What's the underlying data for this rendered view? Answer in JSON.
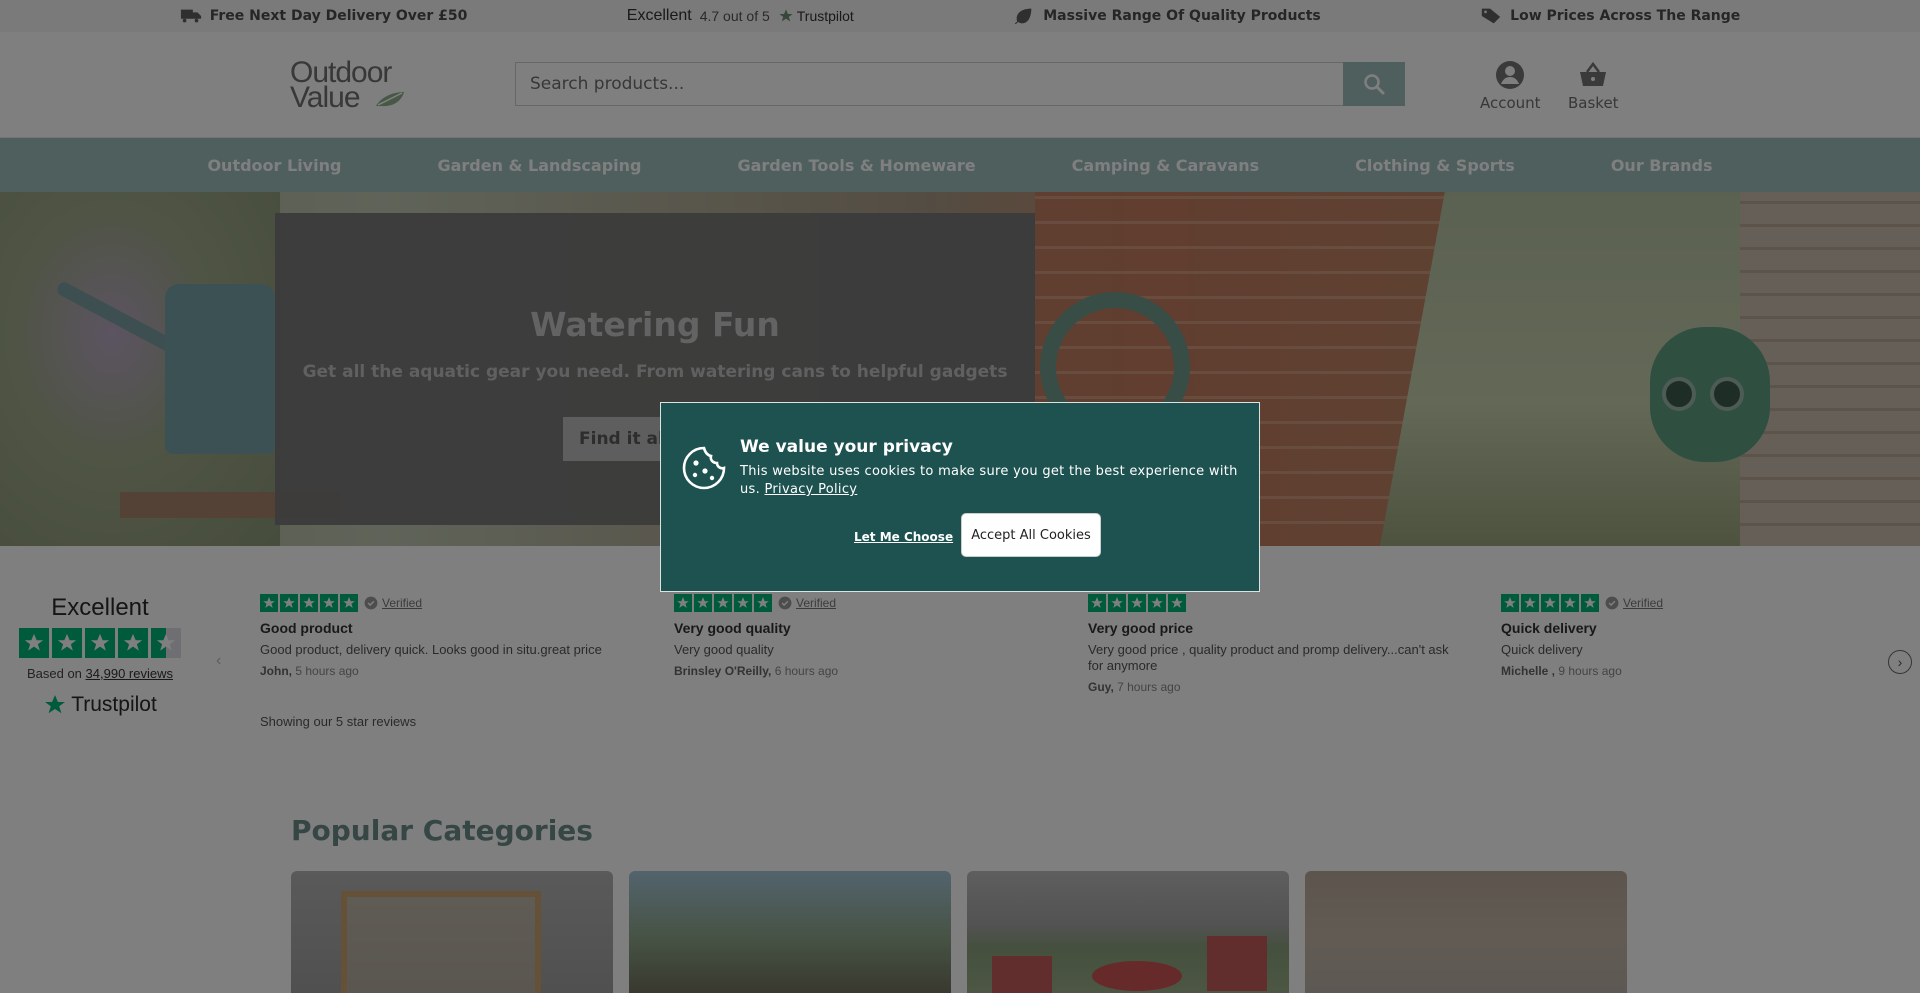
{
  "usp": {
    "delivery": "Free Next Day Delivery Over £50",
    "tp_excellent": "Excellent",
    "tp_score": "4.7 out of 5",
    "tp_brand": "Trustpilot",
    "range": "Massive Range Of Quality Products",
    "prices": "Low Prices Across The Range"
  },
  "header": {
    "logo_line1": "Outdoor",
    "logo_line2": "Value",
    "search_placeholder": "Search products...",
    "account": "Account",
    "basket": "Basket"
  },
  "nav": {
    "items": [
      "Outdoor Living",
      "Garden & Landscaping",
      "Garden Tools & Homeware",
      "Camping & Caravans",
      "Clothing & Sports",
      "Our Brands"
    ]
  },
  "hero": {
    "title": "Watering Fun",
    "subtitle": "Get all the aquatic gear you need. From watering cans to helpful gadgets",
    "button": "Find it all"
  },
  "trustpilot": {
    "excellent": "Excellent",
    "based_prefix": "Based on",
    "reviews_count": "34,990 reviews",
    "brand": "Trustpilot",
    "verified": "Verified",
    "showing": "Showing our 5 star reviews",
    "reviews": [
      {
        "title": "Good product",
        "body": "Good product, delivery quick. Looks good in situ.great price",
        "author": "John,",
        "time": "5 hours ago"
      },
      {
        "title": "Very good quality",
        "body": "Very good quality",
        "author": "Brinsley O'Reilly,",
        "time": "6 hours ago"
      },
      {
        "title": "Very good price",
        "body": "Very good price , quality product and promp delivery...can't ask for anymore",
        "author": "Guy,",
        "time": "7 hours ago"
      },
      {
        "title": "Quick delivery",
        "body": "Quick delivery",
        "author": "Michelle ,",
        "time": "9 hours ago"
      }
    ]
  },
  "categories": {
    "title": "Popular Categories"
  },
  "cookie": {
    "title": "We value your privacy",
    "text": "This website uses cookies to make sure you get the best experience with us.",
    "policy": "Privacy Policy",
    "let_me_choose": "Let Me Choose",
    "accept": "Accept All Cookies"
  },
  "colors": {
    "accent": "#9fbebd",
    "modal": "#1d5250",
    "trustpilot_green": "#00b67a"
  }
}
